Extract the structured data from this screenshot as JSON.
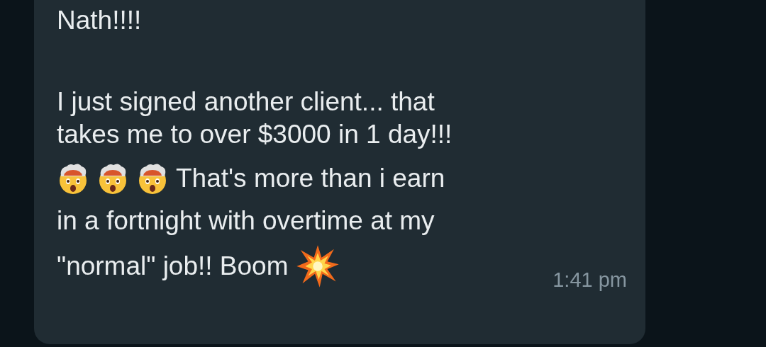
{
  "message": {
    "greeting": "Nath!!!!",
    "rows": [
      [
        {
          "kind": "text",
          "text": "I just signed another client... that"
        }
      ],
      [
        {
          "kind": "text",
          "text": "takes me to over $3000 in 1 day!!!"
        }
      ],
      [
        {
          "kind": "exploding_head"
        },
        {
          "kind": "exploding_head"
        },
        {
          "kind": "exploding_head"
        },
        {
          "kind": "text",
          "text": "That's more than i earn"
        }
      ],
      [
        {
          "kind": "text",
          "text": "in a fortnight with overtime at my"
        }
      ],
      [
        {
          "kind": "text",
          "text": "\"normal\" job!! Boom"
        },
        {
          "kind": "collision"
        }
      ]
    ],
    "time": "1:41 pm"
  }
}
